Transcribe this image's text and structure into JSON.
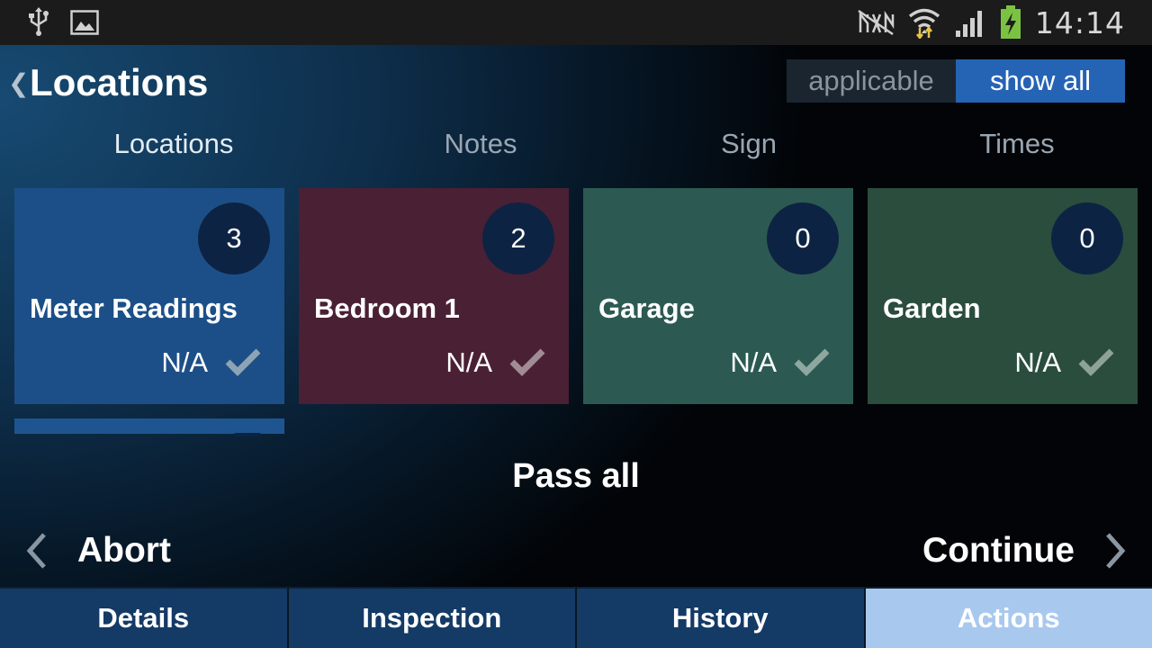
{
  "statusbar": {
    "time": "14:14",
    "left_icons": [
      "usb-icon",
      "image-icon"
    ],
    "right_icons": [
      "no-sim-icon",
      "wifi-icon",
      "signal-icon",
      "battery-charging-icon"
    ]
  },
  "header": {
    "title": "Locations",
    "filter": {
      "applicable_label": "applicable",
      "show_all_label": "show all",
      "selected": "show all"
    }
  },
  "tabs": [
    {
      "label": "Locations",
      "active": true
    },
    {
      "label": "Notes",
      "active": false
    },
    {
      "label": "Sign",
      "active": false
    },
    {
      "label": "Times",
      "active": false
    }
  ],
  "tiles": [
    {
      "name": "Meter Readings",
      "count": "3",
      "status": "N/A",
      "color": "#1c4f87"
    },
    {
      "name": "Bedroom 1",
      "count": "2",
      "status": "N/A",
      "color": "#4a2034"
    },
    {
      "name": "Garage",
      "count": "0",
      "status": "N/A",
      "color": "#2c5a52"
    },
    {
      "name": "Garden",
      "count": "0",
      "status": "N/A",
      "color": "#2a4d3d"
    }
  ],
  "actions": {
    "pass_all": "Pass all",
    "abort": "Abort",
    "continue": "Continue"
  },
  "bottom_tabs": [
    {
      "label": "Details",
      "active": false
    },
    {
      "label": "Inspection",
      "active": false
    },
    {
      "label": "History",
      "active": false
    },
    {
      "label": "Actions",
      "active": true
    }
  ],
  "colors": {
    "accent": "#2563b5",
    "active_bottom_tab": "#a9c8ee",
    "bottom_tab": "#143a66",
    "badge": "#0d2343"
  }
}
